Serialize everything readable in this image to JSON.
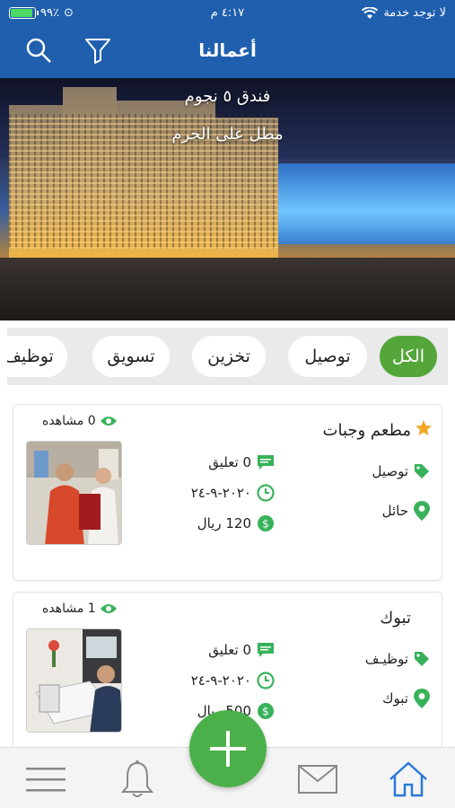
{
  "status": {
    "no_service": "لا توجد خدمة",
    "time": "٤:١٧ م",
    "battery": "٩٩٪"
  },
  "header": {
    "title": "أعمالنا"
  },
  "banner": {
    "line1": "فندق ٥ نجوم",
    "line2": "مطل على الحرم"
  },
  "categories": [
    {
      "label": "الكل",
      "active": true
    },
    {
      "label": "توصيل",
      "active": false
    },
    {
      "label": "تخزين",
      "active": false
    },
    {
      "label": "تسويق",
      "active": false
    },
    {
      "label": "توظيف",
      "active": false
    }
  ],
  "cards": [
    {
      "title": "مطعم وجبات",
      "views": "0 مشاهده",
      "tag": "توصيل",
      "location": "حائل",
      "comments": "0 تعليق",
      "date": "٢٠٢٠-٩-٢٤",
      "price": "120 ريال"
    },
    {
      "title": "تبوك",
      "views": "1 مشاهده",
      "tag": "توظيـف",
      "location": "تبوك",
      "comments": "0 تعليق",
      "date": "٢٠٢٠-٩-٢٤",
      "price": "500 ريال"
    }
  ],
  "colors": {
    "header": "#1f5fae",
    "accent_green": "#4bb04a",
    "chip_active": "#55a63a",
    "star": "#f5a623",
    "nav_active": "#2a78d6"
  },
  "icons": {
    "search": "search-icon",
    "filter": "filter-icon",
    "menu": "menu-icon",
    "bell": "bell-icon",
    "mail": "mail-icon",
    "home": "home-icon",
    "add": "plus-icon"
  }
}
